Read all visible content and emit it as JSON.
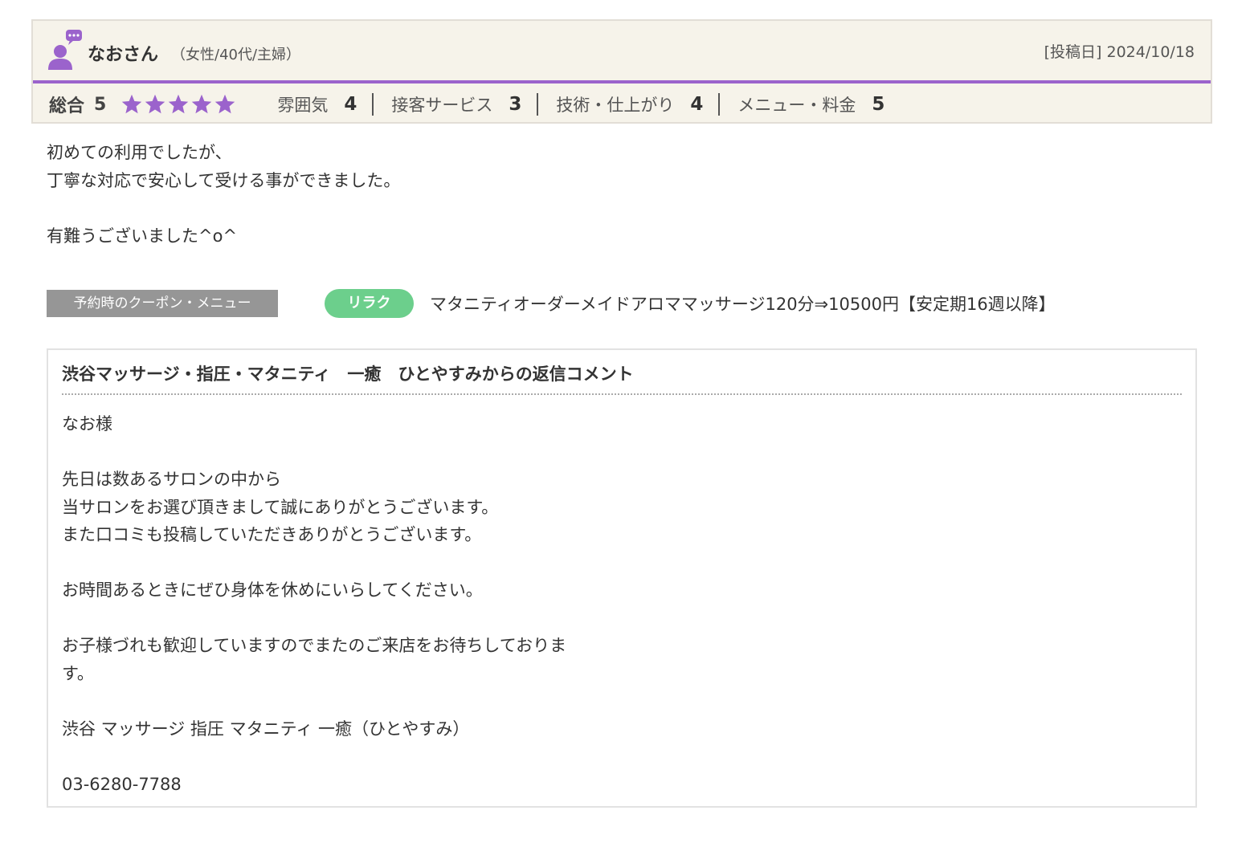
{
  "review": {
    "user_name": "なおさん",
    "user_meta": "（女性/40代/主婦）",
    "post_date": "[投稿日] 2024/10/18",
    "overall_label": "総合",
    "overall_score": "5",
    "star_count": 5,
    "star_color": "#9b63cc",
    "accent_color": "#9b63cc",
    "ratings": [
      {
        "label": "雰囲気",
        "score": "4"
      },
      {
        "label": "接客サービス",
        "score": "3"
      },
      {
        "label": "技術・仕上がり",
        "score": "4"
      },
      {
        "label": "メニュー・料金",
        "score": "5"
      }
    ],
    "body_lines": [
      "初めての利用でしたが、",
      "丁寧な対応で安心して受ける事ができました。",
      "",
      "有難うございました^o^"
    ]
  },
  "coupon": {
    "label": "予約時のクーポン・メニュー",
    "tag": "リラク",
    "tag_color": "#6ccf8c",
    "text": "マタニティオーダーメイドアロママッサージ120分⇒10500円【安定期16週以降】"
  },
  "reply": {
    "title": "渋谷マッサージ・指圧・マタニティ　一癒　ひとやすみからの返信コメント",
    "body_lines": [
      "なお様",
      "",
      "先日は数あるサロンの中から",
      "当サロンをお選び頂きまして誠にありがとうございます。",
      "また口コミも投稿していただきありがとうございます。",
      "",
      "お時間あるときにぜひ身体を休めにいらしてください。",
      "",
      "お子様づれも歓迎していますのでまたのご来店をお待ちしておりま",
      "す。",
      "",
      "渋谷 マッサージ 指圧 マタニティ 一癒（ひとやすみ）",
      "",
      "03-6280-7788"
    ]
  }
}
